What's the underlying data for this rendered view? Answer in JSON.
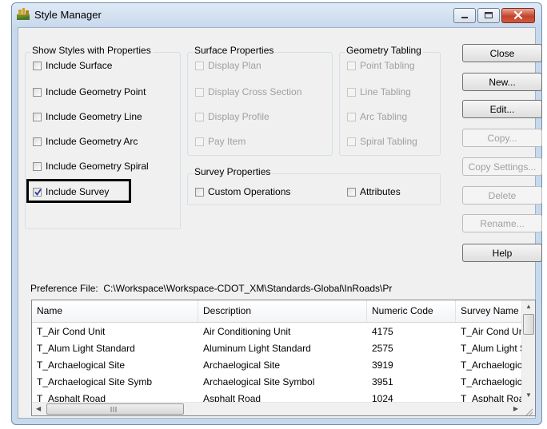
{
  "window": {
    "title": "Style Manager"
  },
  "show_styles": {
    "label": "Show Styles with Properties",
    "items": [
      {
        "label": "Include Surface",
        "checked": false
      },
      {
        "label": "Include Geometry Point",
        "checked": false
      },
      {
        "label": "Include Geometry Line",
        "checked": false
      },
      {
        "label": "Include Geometry Arc",
        "checked": false
      },
      {
        "label": "Include Geometry Spiral",
        "checked": false
      },
      {
        "label": "Include Survey",
        "checked": true
      }
    ]
  },
  "surface_props": {
    "label": "Surface Properties",
    "items": [
      {
        "label": "Display Plan"
      },
      {
        "label": "Display Cross Section"
      },
      {
        "label": "Display Profile"
      },
      {
        "label": "Pay Item"
      }
    ]
  },
  "geometry_tabling": {
    "label": "Geometry Tabling",
    "items": [
      {
        "label": "Point Tabling"
      },
      {
        "label": "Line Tabling"
      },
      {
        "label": "Arc Tabling"
      },
      {
        "label": "Spiral Tabling"
      }
    ]
  },
  "survey_props": {
    "label": "Survey Properties",
    "custom_operations": "Custom Operations",
    "attributes": "Attributes"
  },
  "buttons": {
    "close": "Close",
    "new": "New...",
    "edit": "Edit...",
    "copy": "Copy...",
    "copy_settings": "Copy Settings...",
    "delete": "Delete",
    "rename": "Rename...",
    "help": "Help"
  },
  "preference": {
    "label": "Preference File:",
    "path": "C:\\Workspace\\Workspace-CDOT_XM\\Standards-Global\\InRoads\\Pr"
  },
  "table": {
    "headers": [
      "Name",
      "Description",
      "Numeric Code",
      "Survey Name"
    ],
    "rows": [
      [
        "T_Air Cond Unit",
        "Air Conditioning Unit",
        "4175",
        "T_Air Cond Unit"
      ],
      [
        "T_Alum Light Standard",
        "Aluminum Light Standard",
        "2575",
        "T_Alum Light Standard"
      ],
      [
        "T_Archaelogical Site",
        "Archaelogical Site",
        "3919",
        "T_Archaelogical Site"
      ],
      [
        "T_Archaelogical Site Symb",
        "Archaelogical Site Symbol",
        "3951",
        "T_Archaelogical Site Symb"
      ],
      [
        "T_Asphalt Road",
        "Asphalt Road",
        "1024",
        "T_Asphalt Road"
      ]
    ]
  },
  "colors": {
    "highlight_border": "#000000",
    "close_button": "#c3422b",
    "disabled_text": "#a0a0a0"
  }
}
